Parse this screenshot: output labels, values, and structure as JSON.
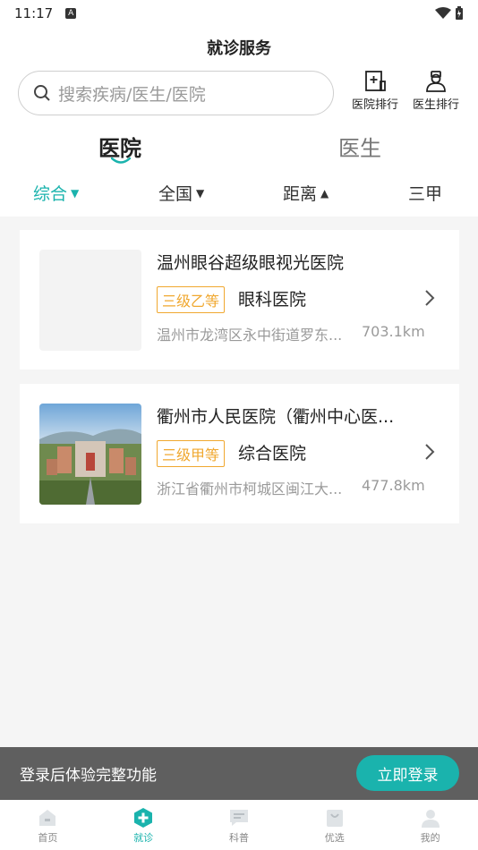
{
  "status": {
    "time": "11:17",
    "a_badge": "A"
  },
  "title": "就诊服务",
  "search": {
    "placeholder": "搜索疾病/医生/医院"
  },
  "rank": {
    "hospital": "医院排行",
    "doctor": "医生排行"
  },
  "tabs": [
    {
      "label": "医院",
      "active": true
    },
    {
      "label": "医生",
      "active": false
    }
  ],
  "filters": [
    {
      "label": "综合",
      "arrow": "▼",
      "active": true
    },
    {
      "label": "全国",
      "arrow": "▼",
      "active": false
    },
    {
      "label": "距离",
      "arrow": "▲",
      "active": false
    },
    {
      "label": "三甲",
      "arrow": "",
      "active": false
    }
  ],
  "hospitals": [
    {
      "name": "温州眼谷超级眼视光医院",
      "level": "三级乙等",
      "type": "眼科医院",
      "address": "温州市龙湾区永中街道罗东...",
      "distance": "703.1km"
    },
    {
      "name": "衢州市人民医院（衢州中心医...",
      "level": "三级甲等",
      "type": "综合医院",
      "address": "浙江省衢州市柯城区闽江大...",
      "distance": "477.8km"
    }
  ],
  "login": {
    "message": "登录后体验完整功能",
    "button": "立即登录"
  },
  "tabbar": [
    {
      "label": "首页",
      "icon": "home-icon"
    },
    {
      "label": "就诊",
      "icon": "medical-cross-icon",
      "active": true
    },
    {
      "label": "科普",
      "icon": "article-icon"
    },
    {
      "label": "优选",
      "icon": "shopping-bag-icon"
    },
    {
      "label": "我的",
      "icon": "user-icon"
    }
  ],
  "colors": {
    "accent": "#1ab3ad",
    "level_badge": "#f0a830"
  }
}
